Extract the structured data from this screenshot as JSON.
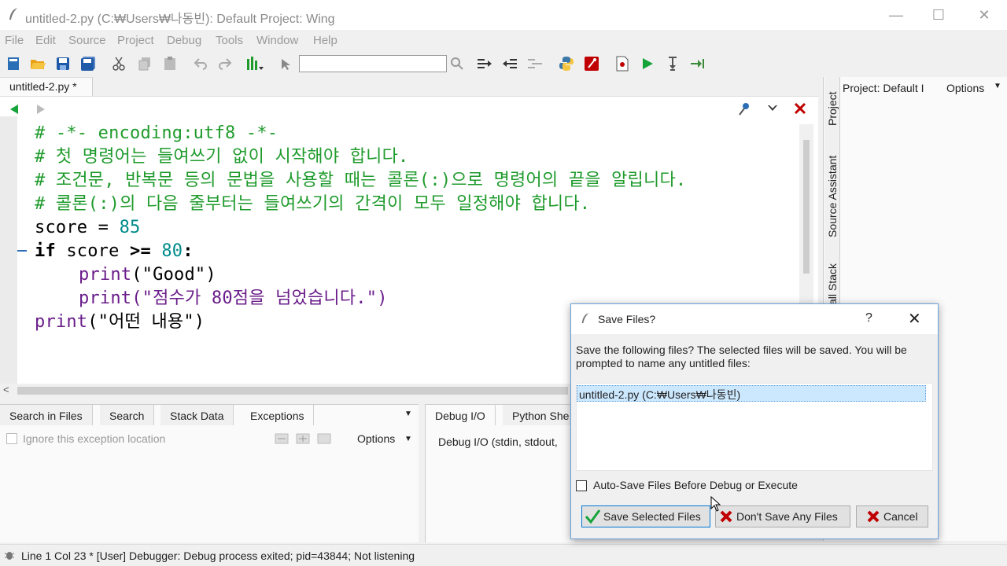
{
  "window": {
    "title": "untitled-2.py (C:₩Users₩나동빈): Default Project: Wing"
  },
  "menu": [
    "File",
    "Edit",
    "Source",
    "Project",
    "Debug",
    "Tools",
    "Window",
    "Help"
  ],
  "toolbar": {
    "search_value": ""
  },
  "editor": {
    "tab_label": "untitled-2.py *",
    "lines": {
      "l1": "# -*- encoding:utf8 -*-",
      "l2": "# 첫 명령어는 들여쓰기 없이 시작해야 합니다.",
      "l3": "# 조건문, 반복문 등의 문법을 사용할 때는 콜론(:)으로 명령어의 끝을 알립니다.",
      "l4": "# 콜론(:)의 다음 줄부터는 들여쓰기의 간격이 모두 일정해야 합니다.",
      "l5_name": "score",
      "l5_op": " = ",
      "l5_num": "85",
      "l6_kw": "if",
      "l6_name": " score ",
      "l6_op": ">=",
      "l6_num": " 80",
      "l6_colon": ":",
      "l7_fn": "print",
      "l7_str": "(\"Good\")",
      "l8_fn": "print",
      "l8_str": "(\"점수가 80점을 넘었습니다.\")",
      "l9_fn": "print",
      "l9_str": "(\"어떤 내용\")"
    }
  },
  "right_panel": {
    "project_label": "Project: Default I",
    "options_label": "Options",
    "vtabs": [
      "Project",
      "Source Assistant",
      "all Stack"
    ]
  },
  "bottom_left": {
    "tabs": [
      "Search in Files",
      "Search",
      "Stack Data",
      "Exceptions"
    ],
    "ignore_label": "Ignore this exception location",
    "options_label": "Options"
  },
  "bottom_right": {
    "tabs": [
      "Debug I/O",
      "Python She"
    ],
    "content": "Debug I/O (stdin, stdout,"
  },
  "status": {
    "text": "Line 1 Col 23 * [User] Debugger: Debug process exited; pid=43844; Not listening"
  },
  "dialog": {
    "title": "Save Files?",
    "help": "?",
    "message": "Save the following files?  The selected files will be saved.  You will be prompted to name any untitled files:",
    "file": "untitled-2.py (C:₩Users₩나동빈)",
    "autosave_label": "Auto-Save Files Before Debug or Execute",
    "btn_save": "Save Selected Files",
    "btn_dont_save": "Don't Save Any Files",
    "btn_cancel": "Cancel"
  },
  "colors": {
    "comment": "#1f9b2c",
    "number": "#008a8a",
    "string": "#6a1d8a",
    "selection": "#cce8ff",
    "accent_red": "#c00000"
  }
}
